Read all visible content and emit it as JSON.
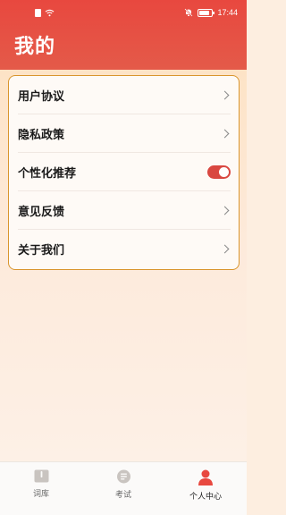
{
  "status_bar": {
    "time": "17:44",
    "icons": [
      "sim-icon",
      "wifi-icon",
      "mute-bell-icon",
      "battery-icon"
    ]
  },
  "header": {
    "title": "我的",
    "background_color": "#e8483f"
  },
  "menu": {
    "border_color": "#d9952d",
    "items": [
      {
        "label": "用户协议",
        "control": "chevron-right-icon"
      },
      {
        "label": "隐私政策",
        "control": "chevron-right-icon"
      },
      {
        "label": "个性化推荐",
        "control": "toggle",
        "toggle_on": true,
        "toggle_color": "#d94741"
      },
      {
        "label": "意见反馈",
        "control": "chevron-right-icon"
      },
      {
        "label": "关于我们",
        "control": "chevron-right-icon"
      }
    ]
  },
  "tabbar": {
    "tabs": [
      {
        "label": "词库",
        "icon": "book-icon",
        "active": false
      },
      {
        "label": "考试",
        "icon": "exam-icon",
        "active": false
      },
      {
        "label": "个人中心",
        "icon": "person-icon",
        "active": true,
        "active_color": "#e8483f"
      }
    ]
  }
}
